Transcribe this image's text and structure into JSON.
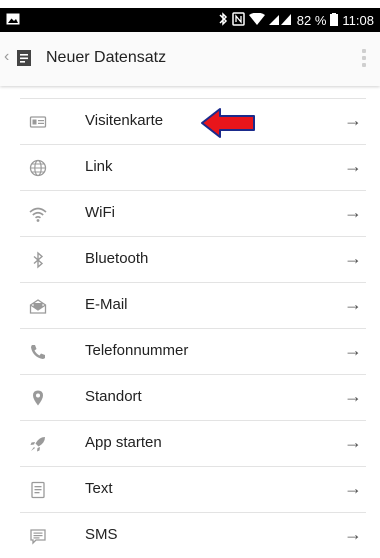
{
  "top_banner": "— — — — — — — — — — — — — — — — —",
  "status_bar": {
    "battery": "82 %",
    "time": "11:08"
  },
  "app_bar": {
    "title": "Neuer Datensatz"
  },
  "arrow_glyph": "→",
  "items": [
    {
      "label": "Visitenkarte",
      "icon": "contact-card-icon"
    },
    {
      "label": "Link",
      "icon": "globe-icon"
    },
    {
      "label": "WiFi",
      "icon": "wifi-icon"
    },
    {
      "label": "Bluetooth",
      "icon": "bluetooth-icon"
    },
    {
      "label": "E-Mail",
      "icon": "mail-icon"
    },
    {
      "label": "Telefonnummer",
      "icon": "phone-icon"
    },
    {
      "label": "Standort",
      "icon": "location-pin-icon"
    },
    {
      "label": "App starten",
      "icon": "rocket-icon"
    },
    {
      "label": "Text",
      "icon": "text-document-icon"
    },
    {
      "label": "SMS",
      "icon": "sms-icon"
    }
  ],
  "colors": {
    "annotation_arrow": "#e8151b",
    "status_bar": "#000000"
  }
}
